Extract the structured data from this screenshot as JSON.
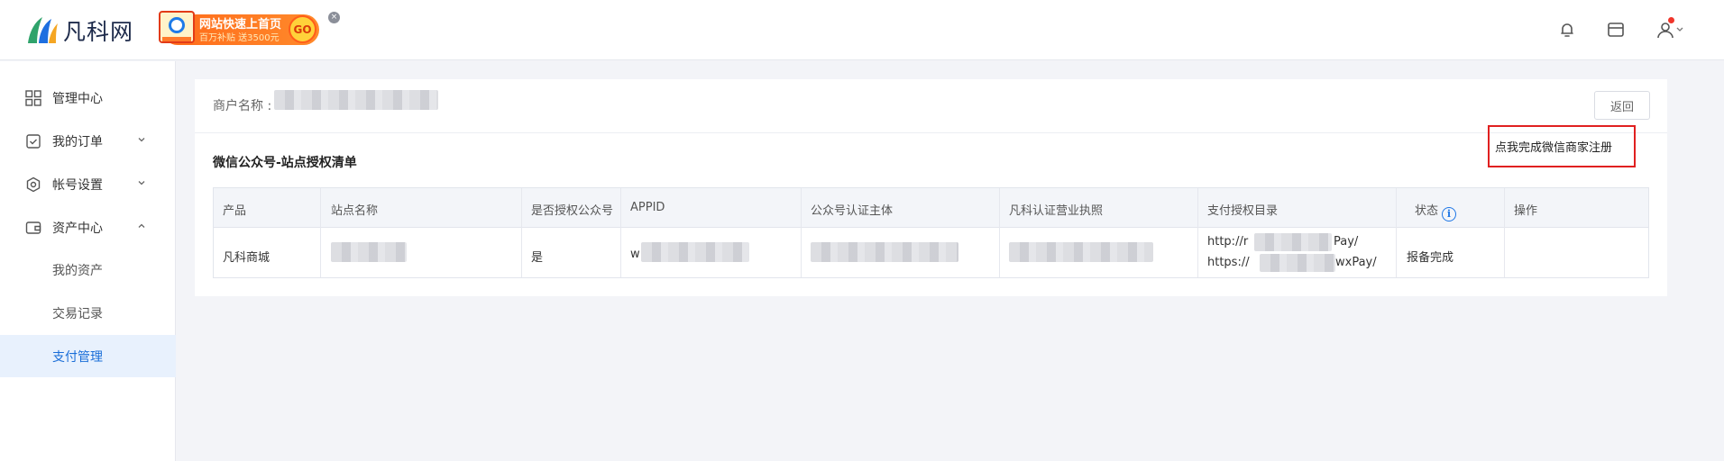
{
  "header": {
    "brand": "凡科网",
    "ad": {
      "title": "网站快速上首页",
      "subtitle": "百万补贴 送3500元",
      "go": "GO",
      "close": "×"
    },
    "icons": [
      "bell-icon",
      "store-icon",
      "user-icon"
    ]
  },
  "sidebar": {
    "items": [
      {
        "label": "管理中心",
        "icon": "grid-icon"
      },
      {
        "label": "我的订单",
        "icon": "order-icon"
      },
      {
        "label": "帐号设置",
        "icon": "settings-icon"
      },
      {
        "label": "资产中心",
        "icon": "wallet-icon"
      }
    ],
    "sub_items": [
      {
        "label": "我的资产"
      },
      {
        "label": "交易记录"
      },
      {
        "label": "支付管理",
        "active": true
      }
    ]
  },
  "main": {
    "merchant_label": "商户名称 :",
    "back_label": "返回",
    "section_title": "微信公众号-站点授权清单",
    "columns": [
      "产品",
      "站点名称",
      "是否授权公众号",
      "APPID",
      "公众号认证主体",
      "凡科认证营业执照",
      "支付授权目录",
      "状态",
      "操作"
    ],
    "row": {
      "product": "凡科商城",
      "site_name_prefix": "",
      "authorized": "是",
      "appid_prefix": "w",
      "pay_dir_1_start": "http://r",
      "pay_dir_1_end": "Pay/",
      "pay_dir_2_start": "https://",
      "pay_dir_2_end": "wxPay/",
      "status": "报备完成",
      "action": "点我完成微信商家注册"
    }
  },
  "colors": {
    "accent": "#1a6ed8",
    "highlight_border": "#e02020",
    "active_bg": "#e8f1fd"
  }
}
